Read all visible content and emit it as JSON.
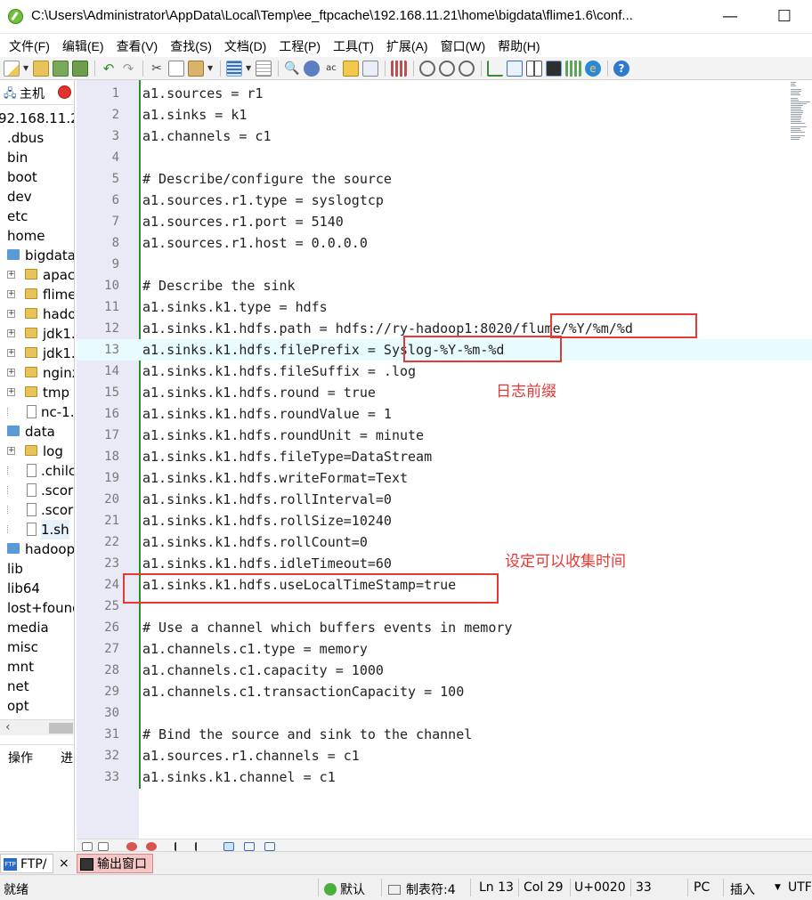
{
  "window": {
    "title": "C:\\Users\\Administrator\\AppData\\Local\\Temp\\ee_ftpcache\\192.168.11.21\\home\\bigdata\\flime1.6\\conf...",
    "minimize_glyph": "—",
    "maximize_glyph": "☐"
  },
  "menu": [
    "文件(F)",
    "编辑(E)",
    "查看(V)",
    "查找(S)",
    "文档(D)",
    "工程(P)",
    "工具(T)",
    "扩展(A)",
    "窗口(W)",
    "帮助(H)"
  ],
  "toolbar_icons": [
    "new-file-icon",
    "dropdown-arrow",
    "open-folder-icon",
    "save-icon",
    "save-all-icon",
    "undo-icon",
    "redo-icon",
    "cut-icon",
    "copy-icon",
    "paste-icon",
    "dropdown-arrow",
    "word-wrap-icon",
    "dropdown-arrow",
    "document-icon",
    "find-icon",
    "find-next-icon",
    "replace-icon",
    "find-in-files-icon",
    "select-all-icon",
    "column-mode-icon",
    "macro-record-icon",
    "macro-play-icon",
    "macro-list-icon",
    "tree-view-icon",
    "panel-icon",
    "split-icon",
    "output-window-icon",
    "table-icon",
    "browser-icon",
    "help-icon"
  ],
  "left_panel": {
    "host_label": "主机",
    "tree": [
      {
        "label": "92.168.11.2",
        "level": 0,
        "type": "host"
      },
      {
        "label": ".dbus",
        "level": 0,
        "type": "plain"
      },
      {
        "label": "bin",
        "level": 0,
        "type": "plain"
      },
      {
        "label": "boot",
        "level": 0,
        "type": "plain"
      },
      {
        "label": "dev",
        "level": 0,
        "type": "plain"
      },
      {
        "label": "etc",
        "level": 0,
        "type": "plain"
      },
      {
        "label": "home",
        "level": 0,
        "type": "plain"
      },
      {
        "label": "bigdata",
        "level": 1,
        "type": "folder-open"
      },
      {
        "label": "apacl",
        "level": 2,
        "type": "folder"
      },
      {
        "label": "flime",
        "level": 2,
        "type": "folder"
      },
      {
        "label": "hado",
        "level": 2,
        "type": "folder"
      },
      {
        "label": "jdk1.",
        "level": 2,
        "type": "folder"
      },
      {
        "label": "jdk1.",
        "level": 2,
        "type": "folder"
      },
      {
        "label": "nginx",
        "level": 2,
        "type": "folder"
      },
      {
        "label": "tmp",
        "level": 2,
        "type": "folder"
      },
      {
        "label": "nc-1.",
        "level": 2,
        "type": "file"
      },
      {
        "label": "data",
        "level": 1,
        "type": "folder-open"
      },
      {
        "label": "log",
        "level": 2,
        "type": "folder"
      },
      {
        "label": ".chilc",
        "level": 2,
        "type": "file"
      },
      {
        "label": ".scor",
        "level": 2,
        "type": "file"
      },
      {
        "label": ".scor",
        "level": 2,
        "type": "file"
      },
      {
        "label": "1.sh",
        "level": 2,
        "type": "file",
        "selected": true
      },
      {
        "label": "hadoop",
        "level": 1,
        "type": "folder-closed"
      },
      {
        "label": "lib",
        "level": 0,
        "type": "plain"
      },
      {
        "label": "lib64",
        "level": 0,
        "type": "plain"
      },
      {
        "label": "lost+found",
        "level": 0,
        "type": "plain"
      },
      {
        "label": "media",
        "level": 0,
        "type": "plain"
      },
      {
        "label": "misc",
        "level": 0,
        "type": "plain"
      },
      {
        "label": "mnt",
        "level": 0,
        "type": "plain"
      },
      {
        "label": "net",
        "level": 0,
        "type": "plain"
      },
      {
        "label": "opt",
        "level": 0,
        "type": "plain"
      }
    ],
    "tabs": [
      "操作",
      "进"
    ]
  },
  "editor": {
    "current_line": 13,
    "lines": [
      "a1.sources = r1",
      "a1.sinks = k1",
      "a1.channels = c1",
      "",
      "# Describe/configure the source",
      "a1.sources.r1.type = syslogtcp",
      "a1.sources.r1.port = 5140",
      "a1.sources.r1.host = 0.0.0.0",
      "",
      "# Describe the sink",
      "a1.sinks.k1.type = hdfs",
      "a1.sinks.k1.hdfs.path = hdfs://ry-hadoop1:8020/flume/%Y/%m/%d",
      "a1.sinks.k1.hdfs.filePrefix = Syslog-%Y-%m-%d",
      "a1.sinks.k1.hdfs.fileSuffix = .log",
      "a1.sinks.k1.hdfs.round = true",
      "a1.sinks.k1.hdfs.roundValue = 1",
      "a1.sinks.k1.hdfs.roundUnit = minute",
      "a1.sinks.k1.hdfs.fileType=DataStream",
      "a1.sinks.k1.hdfs.writeFormat=Text",
      "a1.sinks.k1.hdfs.rollInterval=0",
      "a1.sinks.k1.hdfs.rollSize=10240",
      "a1.sinks.k1.hdfs.rollCount=0",
      "a1.sinks.k1.hdfs.idleTimeout=60",
      "a1.sinks.k1.hdfs.useLocalTimeStamp=true",
      "",
      "# Use a channel which buffers events in memory",
      "a1.channels.c1.type = memory",
      "a1.channels.c1.capacity = 1000",
      "a1.channels.c1.transactionCapacity = 100",
      "",
      "# Bind the source and sink to the channel",
      "a1.sources.r1.channels = c1",
      "a1.sinks.k1.channel = c1"
    ],
    "annotations": {
      "prefix_note": "日志前缀",
      "timestamp_note": "设定可以收集时间"
    },
    "highlight_color": "#e53935"
  },
  "bottom_tabs": {
    "ftp": "FTP/",
    "close": "×",
    "output": "输出窗口"
  },
  "status": {
    "ready": "就绪",
    "encoding_scheme": "默认",
    "tab_setting": "制表符:4",
    "line": "Ln 13",
    "col": "Col 29",
    "char_code": "U+0020",
    "char_dec": "33",
    "line_ending": "PC",
    "insert_mode": "插入",
    "encoding": "UTF"
  }
}
